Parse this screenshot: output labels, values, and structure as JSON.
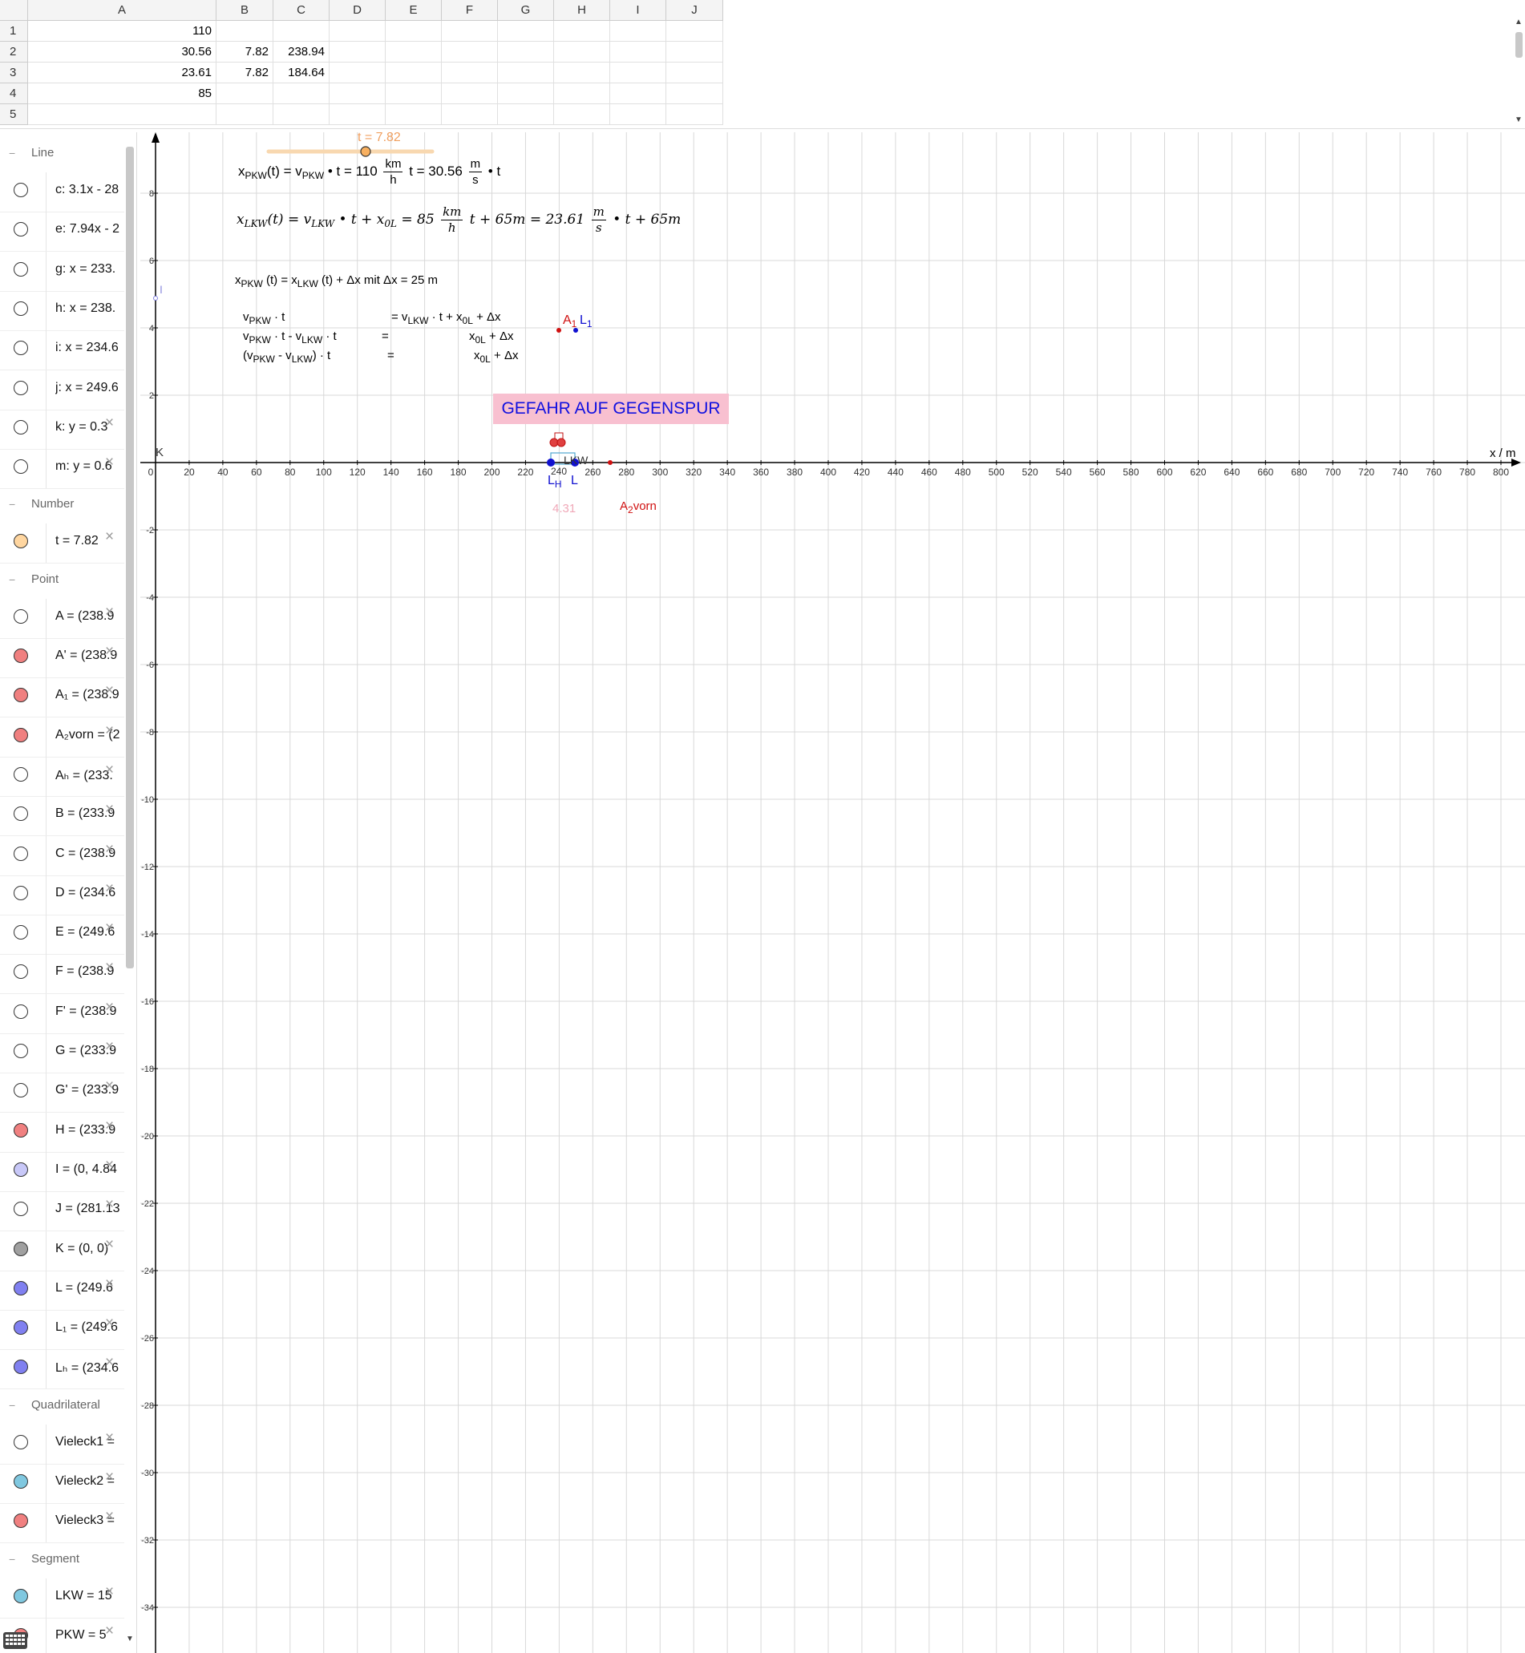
{
  "spreadsheet": {
    "columns": [
      "A",
      "B",
      "C",
      "D",
      "E",
      "F",
      "G",
      "H",
      "I",
      "J"
    ],
    "rows": [
      {
        "num": "1",
        "cells": [
          "110",
          "",
          "",
          "",
          "",
          "",
          "",
          "",
          "",
          ""
        ]
      },
      {
        "num": "2",
        "cells": [
          "30.56",
          "7.82",
          "238.94",
          "",
          "",
          "",
          "",
          "",
          "",
          ""
        ]
      },
      {
        "num": "3",
        "cells": [
          "23.61",
          "7.82",
          "184.64",
          "",
          "",
          "",
          "",
          "",
          "",
          ""
        ]
      },
      {
        "num": "4",
        "cells": [
          "85",
          "",
          "",
          "",
          "",
          "",
          "",
          "",
          "",
          ""
        ]
      },
      {
        "num": "5",
        "cells": [
          "",
          "",
          "",
          "",
          "",
          "",
          "",
          "",
          "",
          ""
        ]
      }
    ]
  },
  "algebra": {
    "groups": [
      {
        "label": "Line",
        "items": [
          {
            "text": "c: 3.1x - 28",
            "color": "#ffffff",
            "delete": false
          },
          {
            "text": "e: 7.94x - 2",
            "color": "#ffffff",
            "delete": false
          },
          {
            "text": "g: x = 233.",
            "color": "#ffffff",
            "delete": false
          },
          {
            "text": "h: x = 238.",
            "color": "#ffffff",
            "delete": false
          },
          {
            "text": "i: x = 234.6",
            "color": "#ffffff",
            "delete": false
          },
          {
            "text": "j: x = 249.6",
            "color": "#ffffff",
            "delete": false
          },
          {
            "text": "k: y = 0.3",
            "color": "#ffffff",
            "delete": true
          },
          {
            "text": "m: y = 0.6",
            "color": "#ffffff",
            "delete": true
          }
        ]
      },
      {
        "label": "Number",
        "items": [
          {
            "text": "t = 7.82",
            "color": "#ffd6a0",
            "delete": true
          }
        ]
      },
      {
        "label": "Point",
        "items": [
          {
            "text": "A = (238.9",
            "color": "#ffffff",
            "delete": true
          },
          {
            "text": "A' = (238.9",
            "color": "#f08080",
            "delete": true
          },
          {
            "text": "A₁ = (238.9",
            "color": "#f08080",
            "delete": true
          },
          {
            "text": "A₂vorn = (2",
            "color": "#f08080",
            "delete": true
          },
          {
            "text": "Aₕ = (233.",
            "color": "#ffffff",
            "delete": true
          },
          {
            "text": "B = (233.9",
            "color": "#ffffff",
            "delete": true
          },
          {
            "text": "C = (238.9",
            "color": "#ffffff",
            "delete": true
          },
          {
            "text": "D = (234.6",
            "color": "#ffffff",
            "delete": true
          },
          {
            "text": "E = (249.6",
            "color": "#ffffff",
            "delete": true
          },
          {
            "text": "F = (238.9",
            "color": "#ffffff",
            "delete": true
          },
          {
            "text": "F' = (238.9",
            "color": "#ffffff",
            "delete": true
          },
          {
            "text": "G = (233.9",
            "color": "#ffffff",
            "delete": true
          },
          {
            "text": "G' = (233.9",
            "color": "#ffffff",
            "delete": true
          },
          {
            "text": "H = (233.9",
            "color": "#f08080",
            "delete": true
          },
          {
            "text": "I = (0, 4.84",
            "color": "#c8c8f8",
            "delete": true
          },
          {
            "text": "J = (281.13",
            "color": "#ffffff",
            "delete": true
          },
          {
            "text": "K = (0, 0)",
            "color": "#a0a0a0",
            "delete": true
          },
          {
            "text": "L = (249.6",
            "color": "#8080f0",
            "delete": true
          },
          {
            "text": "L₁ = (249.6",
            "color": "#8080f0",
            "delete": true
          },
          {
            "text": "Lₕ = (234.6",
            "color": "#8080f0",
            "delete": true
          }
        ]
      },
      {
        "label": "Quadrilateral",
        "items": [
          {
            "text": "Vieleck1 =",
            "color": "#ffffff",
            "delete": true
          },
          {
            "text": "Vieleck2 =",
            "color": "#80c8e0",
            "delete": true
          },
          {
            "text": "Vieleck3 =",
            "color": "#f08080",
            "delete": true
          }
        ]
      },
      {
        "label": "Segment",
        "items": [
          {
            "text": "LKW = 15",
            "color": "#80c8e0",
            "delete": true
          },
          {
            "text": "PKW = 5",
            "color": "#f08080",
            "delete": true
          }
        ]
      }
    ]
  },
  "graphics": {
    "x_axis_label": "x / m",
    "x_ticks": [
      "0",
      "20",
      "40",
      "60",
      "80",
      "100",
      "120",
      "140",
      "160",
      "180",
      "200",
      "220",
      "240",
      "260",
      "280",
      "300",
      "320",
      "340",
      "360",
      "380",
      "400",
      "420",
      "440",
      "460",
      "480",
      "500",
      "520",
      "540",
      "560",
      "580",
      "600",
      "620",
      "640",
      "660",
      "680",
      "700",
      "720",
      "740",
      "760",
      "780",
      "800"
    ],
    "y_ticks": [
      "8",
      "6",
      "4",
      "2",
      "-2",
      "-4",
      "-6",
      "-8",
      "-10",
      "-12",
      "-14",
      "-16",
      "-18",
      "-20",
      "-22",
      "-24",
      "-26",
      "-28",
      "-30",
      "-32",
      "-34"
    ],
    "slider_label": "t = 7.82",
    "slider_value": 7.82,
    "warning_text": "GEFAHR AUF GEGENSPUR",
    "labels": {
      "K": "K",
      "A1": "A",
      "A1_sub": "1",
      "L1": "L",
      "L1_sub": "1",
      "LH": "L",
      "LH_sub": "H",
      "L": "L",
      "LKW": "LKW",
      "tick240": "240",
      "value_431": "4.31",
      "A2vorn": "A",
      "A2vorn_sub": "2",
      "A2vorn_suffix": "vorn",
      "I": "I"
    },
    "formulas": {
      "pkw": {
        "lhs": "x",
        "lhs_sub": "PKW",
        "arg": "(t) = v",
        "v_sub": "PKW",
        "mid1": "• t = 110",
        "num1": "km",
        "den1": "h",
        "mid2": "t = 30.56",
        "num2": "m",
        "den2": "s",
        "end": "• t"
      },
      "lkw": {
        "lhs": "x",
        "lhs_sub": "LKW",
        "arg": "(t) = v",
        "v_sub": "LKW",
        "mid1": "• t + x",
        "x_sub": "0L",
        "mid2": "= 85",
        "num1": "km",
        "den1": "h",
        "mid3": "t + 65m = 23.61",
        "num2": "m",
        "den2": "s",
        "end": "• t + 65m"
      },
      "cond": {
        "a": "x",
        "a_sub": "PKW",
        "b": " (t) = x",
        "b_sub": "LKW",
        "c": " (t) + Δx    mit Δx = 25 m"
      },
      "eq1": {
        "l1": "v",
        "l1s": "PKW",
        "l2": " · t",
        "r1": "=  v",
        "r1s": "LKW",
        "r2": " · t + x",
        "r2s": "0L",
        "r3": " + Δx"
      },
      "eq2": {
        "l1": "v",
        "l1s": "PKW",
        "l2": " · t  -  v",
        "l2s": "LKW",
        "l3": " · t",
        "r0": "=",
        "r1": "x",
        "r1s": "0L",
        "r2": " + Δx"
      },
      "eq3": {
        "l1": "(v",
        "l1s": "PKW",
        "l2": " - v",
        "l2s": "LKW",
        "l3": ") · t",
        "r0": "=",
        "r1": "x",
        "r1s": "0L",
        "r2": " + Δx"
      }
    }
  }
}
